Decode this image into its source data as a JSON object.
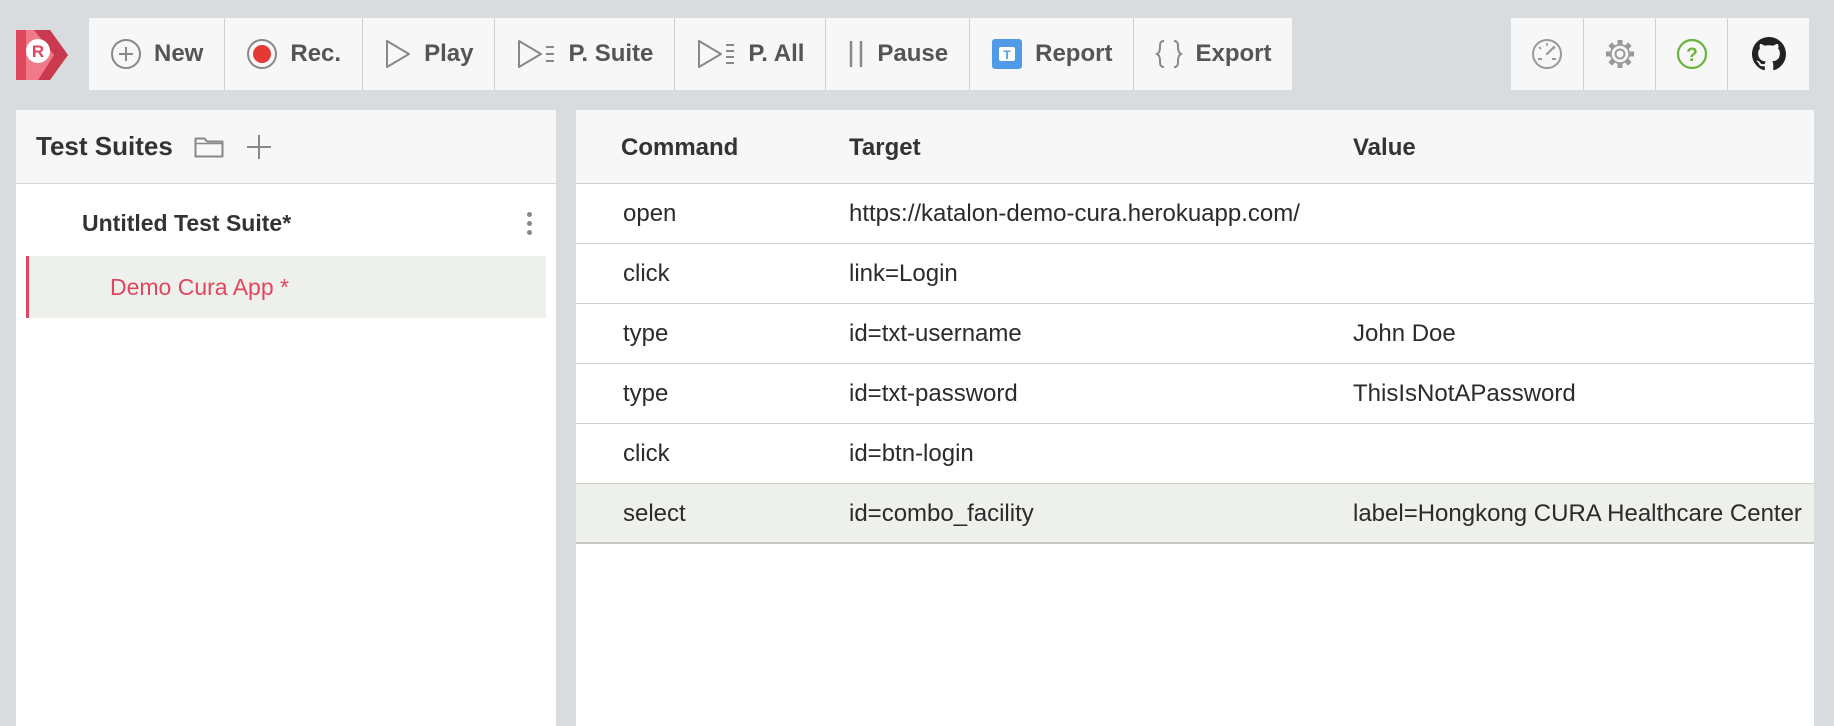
{
  "app": {
    "logo_letter": "R",
    "brand_color": "#e0475e"
  },
  "toolbar": {
    "buttons": [
      {
        "label": "New",
        "icon": "plus-circle-icon"
      },
      {
        "label": "Rec.",
        "icon": "record-icon"
      },
      {
        "label": "Play",
        "icon": "play-icon"
      },
      {
        "label": "P. Suite",
        "icon": "play-suite-icon"
      },
      {
        "label": "P. All",
        "icon": "play-all-icon"
      },
      {
        "label": "Pause",
        "icon": "pause-icon"
      },
      {
        "label": "Report",
        "icon": "testops-icon"
      },
      {
        "label": "Export",
        "icon": "braces-icon"
      }
    ],
    "right_icons": [
      "speedometer-icon",
      "gear-icon",
      "help-icon",
      "github-icon"
    ],
    "help_color": "#6ab43e"
  },
  "left_panel": {
    "title": "Test Suites",
    "suites": [
      {
        "name": "Untitled Test Suite*",
        "cases": [
          {
            "name": "Demo Cura App *",
            "selected": true
          }
        ]
      }
    ]
  },
  "commands": {
    "headers": {
      "command": "Command",
      "target": "Target",
      "value": "Value"
    },
    "rows": [
      {
        "command": "open",
        "target": "https://katalon-demo-cura.herokuapp.com/",
        "value": ""
      },
      {
        "command": "click",
        "target": "link=Login",
        "value": ""
      },
      {
        "command": "type",
        "target": "id=txt-username",
        "value": "John Doe"
      },
      {
        "command": "type",
        "target": "id=txt-password",
        "value": "ThisIsNotAPassword"
      },
      {
        "command": "click",
        "target": "id=btn-login",
        "value": ""
      },
      {
        "command": "select",
        "target": "id=combo_facility",
        "value": "label=Hongkong CURA Healthcare Center",
        "selected": true
      }
    ]
  }
}
